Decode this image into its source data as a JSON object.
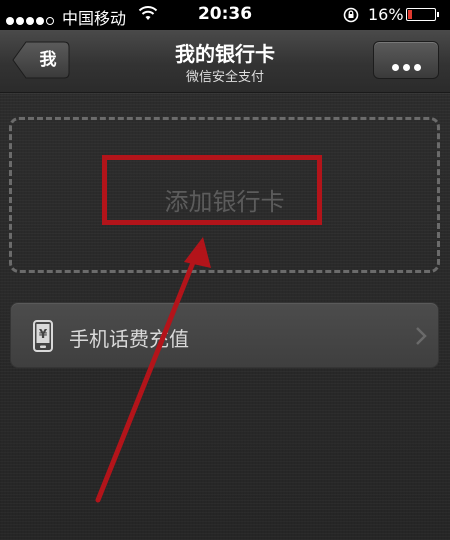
{
  "status_bar": {
    "carrier": "中国移动",
    "time": "20:36",
    "battery": "16%",
    "battery_level": 0.16
  },
  "navbar": {
    "back_label": "我",
    "title": "我的银行卡",
    "subtitle": "微信安全支付"
  },
  "add_card": {
    "label": "添加银行卡"
  },
  "topup": {
    "label": "手机话费充值"
  },
  "colors": {
    "annotation_red": "#b3141a",
    "battery_red": "#e03a2f"
  }
}
